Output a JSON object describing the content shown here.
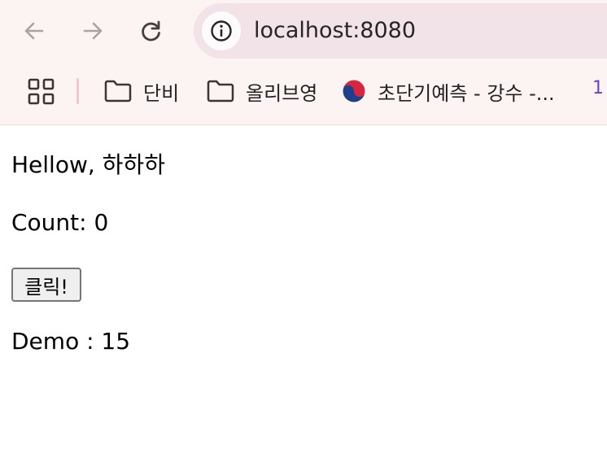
{
  "browser": {
    "url": "localhost:8080",
    "nav": {
      "back": "back-arrow-icon",
      "forward": "forward-arrow-icon",
      "reload": "reload-icon"
    },
    "bookmarks": [
      {
        "label": "단비",
        "icon": "folder-icon"
      },
      {
        "label": "올리브영",
        "icon": "folder-icon"
      },
      {
        "label": "초단기예측 - 강수 -...",
        "icon": "taegeuk-icon"
      }
    ]
  },
  "page": {
    "greeting": "Hellow, 하하하",
    "count_text": "Count: 0",
    "button_label": "클릭!",
    "demo_text": "Demo : 15"
  },
  "colors": {
    "chrome_bg": "#fcf4f2",
    "omnibox_bg": "#f1e3e8",
    "accent": "#6a3fd6"
  }
}
